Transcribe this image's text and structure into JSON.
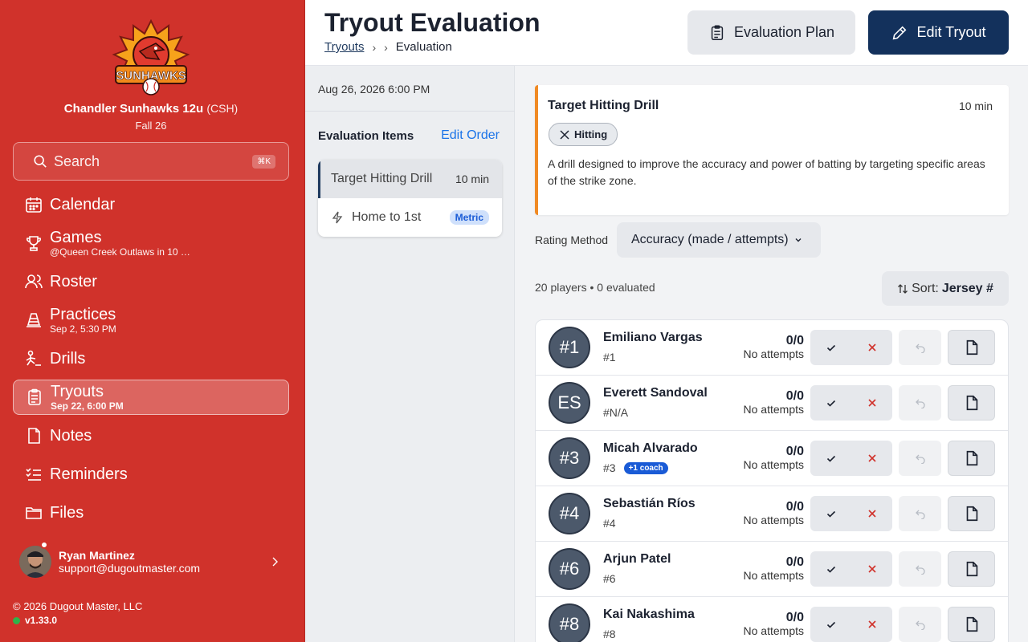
{
  "sidebar": {
    "logo_text": "CHANDLER SUNHAWKS",
    "team_name": "Chandler Sunhawks 12u",
    "team_abbr": "(CSH)",
    "season": "Fall 26",
    "search": {
      "label": "Search",
      "shortcut": "⌘K"
    },
    "items": [
      {
        "label": "Calendar",
        "sub": "",
        "icon": "calendar-icon"
      },
      {
        "label": "Games",
        "sub": "@Queen Creek Outlaws in 10 …",
        "icon": "trophy-icon"
      },
      {
        "label": "Roster",
        "sub": "",
        "icon": "users-icon"
      },
      {
        "label": "Practices",
        "sub": "Sep 2, 5:30 PM",
        "icon": "cone-icon"
      },
      {
        "label": "Drills",
        "sub": "",
        "icon": "drill-icon"
      },
      {
        "label": "Tryouts",
        "sub": "Sep 22, 6:00 PM",
        "icon": "clipboard-icon",
        "active": true
      },
      {
        "label": "Notes",
        "sub": "",
        "icon": "note-icon"
      },
      {
        "label": "Reminders",
        "sub": "",
        "icon": "checklist-icon"
      },
      {
        "label": "Files",
        "sub": "",
        "icon": "folder-icon"
      }
    ],
    "user": {
      "name": "Ryan Martinez",
      "email": "support@dugoutmaster.com"
    },
    "footer": "© 2026 Dugout Master, LLC",
    "version": "v1.33.0"
  },
  "header": {
    "title": "Tryout Evaluation",
    "breadcrumb": {
      "link": "Tryouts",
      "current": "Evaluation"
    },
    "plan_button": "Evaluation Plan",
    "edit_button": "Edit Tryout"
  },
  "middle": {
    "date": "Aug 26, 2026 6:00 PM",
    "heading": "Evaluation Items",
    "edit_order": "Edit Order",
    "items": [
      {
        "name": "Target Hitting Drill",
        "duration": "10 min"
      },
      {
        "name": "Home to 1st",
        "badge": "Metric"
      }
    ]
  },
  "drill": {
    "name": "Target Hitting Drill",
    "duration": "10 min",
    "tag": "Hitting",
    "description": "A drill designed to improve the accuracy and power of batting by targeting specific areas of the strike zone."
  },
  "rating": {
    "label": "Rating Method",
    "value": "Accuracy (made / attempts)"
  },
  "summary": {
    "count": "20 players • 0 evaluated",
    "sort_label": "Sort:",
    "sort_value": "Jersey #"
  },
  "players": [
    {
      "initials": "#1",
      "name": "Emiliano Vargas",
      "number": "#1",
      "score": "0/0",
      "attempts": "No attempts",
      "coach": ""
    },
    {
      "initials": "ES",
      "name": "Everett Sandoval",
      "number": "#N/A",
      "score": "0/0",
      "attempts": "No attempts",
      "coach": ""
    },
    {
      "initials": "#3",
      "name": "Micah Alvarado",
      "number": "#3",
      "score": "0/0",
      "attempts": "No attempts",
      "coach": "+1 coach"
    },
    {
      "initials": "#4",
      "name": "Sebastián Ríos",
      "number": "#4",
      "score": "0/0",
      "attempts": "No attempts",
      "coach": ""
    },
    {
      "initials": "#6",
      "name": "Arjun Patel",
      "number": "#6",
      "score": "0/0",
      "attempts": "No attempts",
      "coach": ""
    },
    {
      "initials": "#8",
      "name": "Kai Nakashima",
      "number": "#8",
      "score": "0/0",
      "attempts": "No attempts",
      "coach": ""
    }
  ],
  "colors": {
    "sidebar": "#d0322b",
    "primary": "#13315c",
    "accent": "#f08a24",
    "link": "#1a73e8"
  }
}
